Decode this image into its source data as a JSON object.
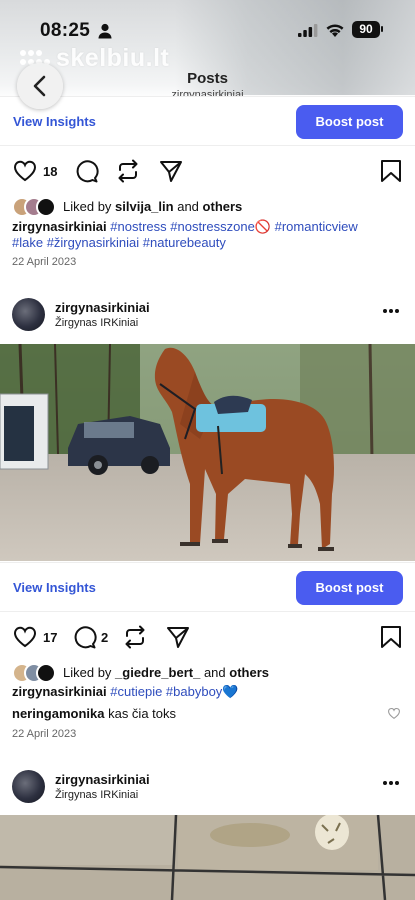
{
  "status_bar": {
    "time": "08:25",
    "battery": "90"
  },
  "watermark": "skelbiu.lt",
  "nav": {
    "title": "Posts",
    "subtitle": "zirgynasirkiniai"
  },
  "insights_label": "View Insights",
  "boost_label": "Boost post",
  "post1": {
    "like_count": "18",
    "liked_prefix": "Liked by",
    "liked_user": "silvija_lin",
    "liked_and": "and",
    "liked_others": "others",
    "caption_user": "zirgynasirkiniai",
    "caption_tags_line1": "#nostress #nostresszone",
    "emoji": "🚫",
    "caption_tags_line1b": "#romanticview",
    "caption_tags_line2": "#lake #žirgynasirkiniai #naturebeauty",
    "date": "22 April 2023"
  },
  "post2": {
    "username": "zirgynasirkiniai",
    "location": "Žirgynas IRKiniai",
    "like_count": "17",
    "comment_count": "2",
    "liked_prefix": "Liked by",
    "liked_user": "_giedre_bert_",
    "liked_and": "and",
    "liked_others": "others",
    "caption_user": "zirgynasirkiniai",
    "caption_tags": "#cutiepie #babyboy",
    "heart_emoji": "💙",
    "comment_user": "neringamonika",
    "comment_text": "kas čia toks",
    "date": "22 April 2023"
  },
  "post3": {
    "username": "zirgynasirkiniai",
    "location": "Žirgynas IRKiniai"
  },
  "icons": [
    "heart-icon",
    "comment-icon",
    "repost-icon",
    "send-icon",
    "bookmark-icon",
    "more-icon",
    "back-chevron-icon"
  ],
  "colors": {
    "accent": "#4a5cf0",
    "link": "#3456d6",
    "hashtag": "#2f4dbd"
  }
}
